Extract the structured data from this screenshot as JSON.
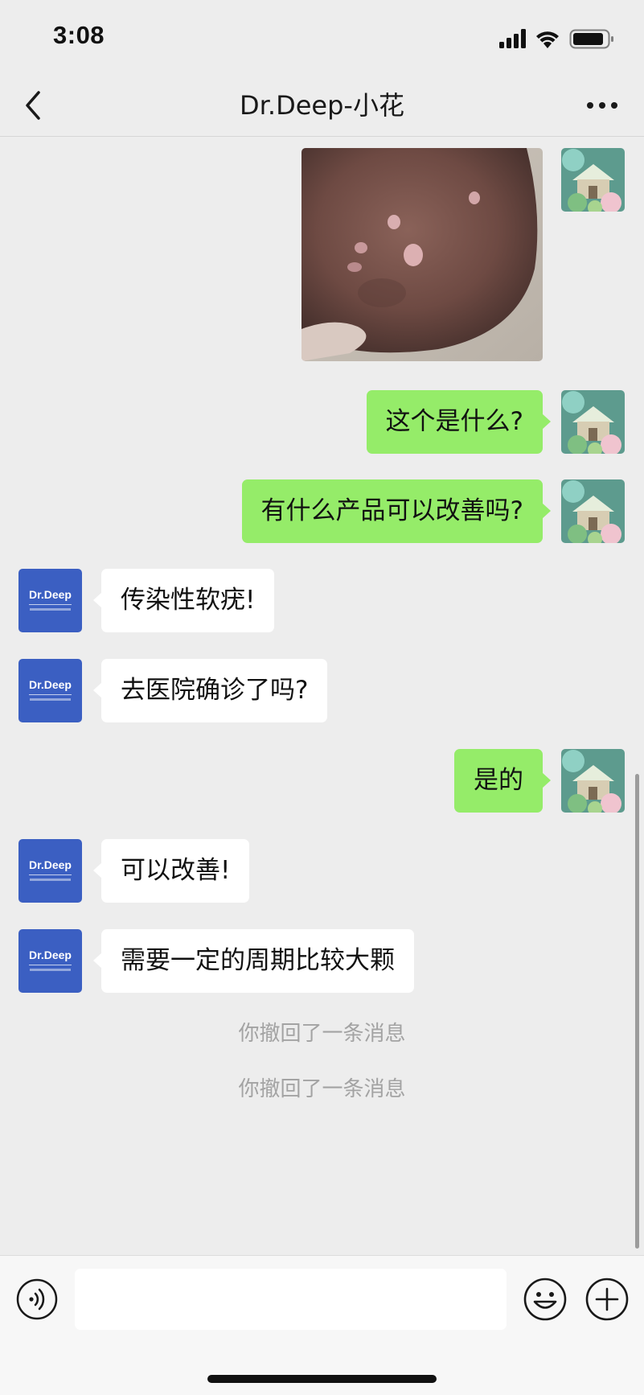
{
  "status_bar": {
    "time": "3:08",
    "icons": [
      "signal-icon",
      "wifi-icon",
      "battery-icon"
    ]
  },
  "nav": {
    "title": "Dr.Deep-小花",
    "back_icon": "chevron-left-icon",
    "more_icon": "more-icon"
  },
  "messages": [
    {
      "from": "me",
      "type": "image"
    },
    {
      "from": "me",
      "type": "text",
      "text": "这个是什么?"
    },
    {
      "from": "me",
      "type": "text",
      "text": "有什么产品可以改善吗?"
    },
    {
      "from": "bot",
      "type": "text",
      "text": "传染性软疣!"
    },
    {
      "from": "bot",
      "type": "text",
      "text": "去医院确诊了吗?"
    },
    {
      "from": "me",
      "type": "text",
      "text": "是的"
    },
    {
      "from": "bot",
      "type": "text",
      "text": "可以改善!"
    },
    {
      "from": "bot",
      "type": "text",
      "text": "需要一定的周期比较大颗"
    }
  ],
  "bot_avatar_label": "Dr.Deep",
  "recall_notices": [
    "你撤回了一条消息",
    "你撤回了一条消息"
  ],
  "input_bar": {
    "message_value": "",
    "voice_icon": "voice-icon",
    "emoji_icon": "emoji-icon",
    "plus_icon": "plus-icon"
  },
  "colors": {
    "background": "#ededed",
    "my_bubble": "#95ec69",
    "bot_bubble": "#ffffff",
    "bot_avatar": "#3b5fc2"
  }
}
